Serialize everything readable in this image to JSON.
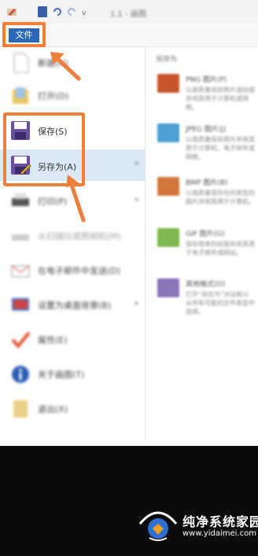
{
  "titlebar": {
    "separator": "v",
    "doc_title": "1.1 - 画图"
  },
  "file_tab": {
    "label": "文件"
  },
  "menu": {
    "items": [
      {
        "key": "new",
        "label": "新建(N)",
        "icon": "new-document-icon"
      },
      {
        "key": "open",
        "label": "打开(O)",
        "icon": "open-folder-icon"
      },
      {
        "key": "save",
        "label": "保存(S)",
        "icon": "save-disk-icon"
      },
      {
        "key": "save_as",
        "label": "另存为(A)",
        "icon": "save-as-icon"
      },
      {
        "key": "print",
        "label": "打印(P)",
        "icon": "printer-icon"
      },
      {
        "key": "scanner",
        "label": "从扫描仪或照相机(M)",
        "icon": "scanner-icon"
      },
      {
        "key": "email",
        "label": "在电子邮件中发送(D)",
        "icon": "email-icon"
      },
      {
        "key": "wallpaper",
        "label": "设置为桌面背景(B)",
        "icon": "wallpaper-icon"
      },
      {
        "key": "properties",
        "label": "属性(E)",
        "icon": "checkmark-icon"
      },
      {
        "key": "about",
        "label": "关于画图(T)",
        "icon": "info-icon"
      },
      {
        "key": "exit",
        "label": "退出(X)",
        "icon": "exit-icon"
      }
    ]
  },
  "save_as_pane": {
    "heading": "另存为",
    "options": [
      {
        "title": "PNG 图片(P)",
        "desc": "以高质量保存照片或绘图并将其用于计算机或网络。",
        "icon": "png-image-icon",
        "color": "#c8552c"
      },
      {
        "title": "JPEG 图片(J)",
        "desc": "以高质量保存照片并将其用于计算机、电子邮件或网络。",
        "icon": "jpeg-image-icon",
        "color": "#4b9fd4"
      },
      {
        "title": "BMP 图片(B)",
        "desc": "以高质量保存任何类型的图片并将其用于计算机。",
        "icon": "bmp-image-icon",
        "color": "#d1763b"
      },
      {
        "title": "GIF 图片(G)",
        "desc": "保存简单的绘图并将其用于电子邮件或网站。",
        "icon": "gif-image-icon",
        "color": "#7fb84e"
      },
      {
        "title": "其他格式(O)",
        "desc": "打开“另存为”对话框以从所有可能的文件类型中选择。",
        "icon": "other-format-icon",
        "color": "#8a76b8"
      }
    ]
  },
  "watermark": {
    "name": "纯净系统家园",
    "url": "www.yidaimei.com"
  },
  "colors": {
    "accent_orange": "#ee7f3a",
    "file_tab_blue": "#2b67b8",
    "highlight": "#dbe8f6"
  }
}
